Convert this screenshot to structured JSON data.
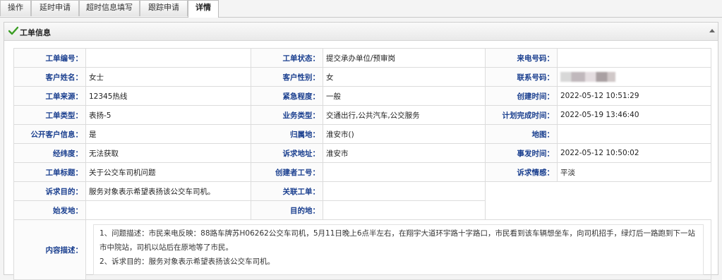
{
  "tabs": [
    {
      "label": "操作",
      "active": false
    },
    {
      "label": "延时申请",
      "active": false
    },
    {
      "label": "超时信息填写",
      "active": false
    },
    {
      "label": "跟踪申请",
      "active": false
    },
    {
      "label": "详情",
      "active": true
    }
  ],
  "panel": {
    "title": "工单信息"
  },
  "fields": {
    "order_no": {
      "label": "工单编号：",
      "value": ""
    },
    "order_status": {
      "label": "工单状态：",
      "value": "提交承办单位/预审岗"
    },
    "caller_no": {
      "label": "来电号码：",
      "value": ""
    },
    "customer_name": {
      "label": "客户姓名：",
      "value": "女士"
    },
    "customer_gender": {
      "label": "客户性别：",
      "value": "女"
    },
    "contact_no": {
      "label": "联系号码：",
      "value": ""
    },
    "source": {
      "label": "工单来源：",
      "value": "12345热线"
    },
    "urgency": {
      "label": "紧急程度：",
      "value": "一般"
    },
    "created_at": {
      "label": "创建时间：",
      "value": "2022-05-12 10:51:29"
    },
    "order_type": {
      "label": "工单类型：",
      "value": "表扬-5"
    },
    "business_type": {
      "label": "业务类型：",
      "value": "交通出行,公共汽车,公交服务"
    },
    "planned_finish": {
      "label": "计划完成时间：",
      "value": "2022-05-19 13:46:40"
    },
    "public_info": {
      "label": "公开客户信息：",
      "value": "是"
    },
    "locality": {
      "label": "归属地：",
      "value": "淮安市()"
    },
    "map": {
      "label": "地图：",
      "value": ""
    },
    "lnglat": {
      "label": "经纬度：",
      "value": "无法获取"
    },
    "appeal_address": {
      "label": "诉求地址：",
      "value": "淮安市"
    },
    "incident_time": {
      "label": "事发时间：",
      "value": "2022-05-12 10:50:02"
    },
    "order_title": {
      "label": "工单标题：",
      "value": "关于公交车司机问题"
    },
    "creator_id": {
      "label": "创建者工号：",
      "value": ""
    },
    "appeal_emotion": {
      "label": "诉求情感：",
      "value": "平淡"
    },
    "appeal_purpose": {
      "label": "诉求目的：",
      "value": "服务对象表示希望表扬该公交车司机。"
    },
    "related_order": {
      "label": "关联工单：",
      "value": ""
    },
    "origin": {
      "label": "始发地：",
      "value": ""
    },
    "destination": {
      "label": "目的地：",
      "value": ""
    },
    "content": {
      "label": "内容描述：",
      "line1": "1、问题描述：市民来电反映：88路车牌苏H06262公交车司机，5月11日晚上6点半左右，在翔宇大道环宇路十字路口，市民看到该车辆想坐车，向司机招手，绿灯后一路跑到下一站市中院站，司机以站后在原地等了市民。",
      "line2": "2、诉求目的：服务对象表示希望表扬该公交车司机。"
    }
  }
}
